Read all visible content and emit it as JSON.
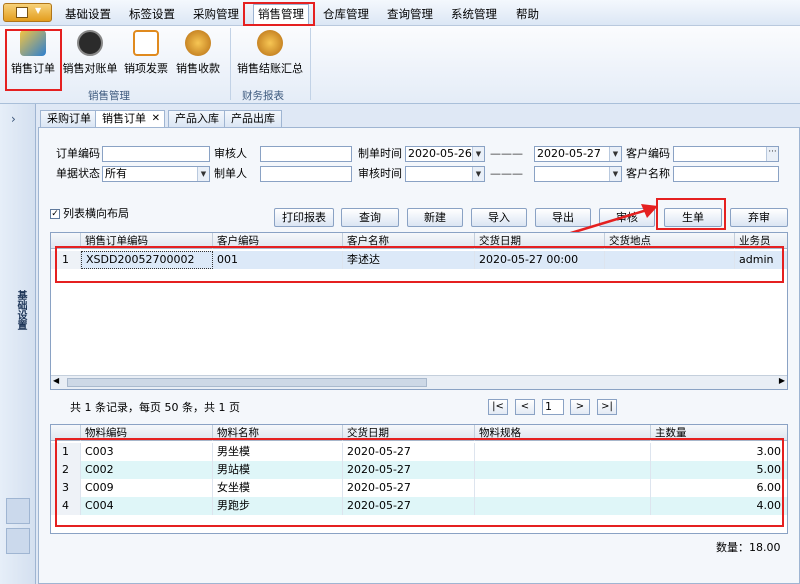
{
  "menubar": {
    "items": [
      "基础设置",
      "标签设置",
      "采购管理",
      "销售管理",
      "仓库管理",
      "查询管理",
      "系统管理",
      "帮助"
    ],
    "active": "销售管理"
  },
  "ribbon": {
    "buttons": [
      "销售订单",
      "销售对账单",
      "销项发票",
      "销售收款",
      "销售结账汇总"
    ],
    "groups": [
      "销售管理",
      "财务报表"
    ]
  },
  "leftpanel": {
    "label": "基础设置"
  },
  "tabs": [
    "采购订单",
    "销售订单",
    "产品入库",
    "产品出库"
  ],
  "filters": {
    "order_no_label": "订单编码",
    "reviewer_label": "审核人",
    "created_time_label": "制单时间",
    "date_from": "2020-05-26",
    "date_sep": "———",
    "date_to": "2020-05-27",
    "customer_code_label": "客户编码",
    "status_label": "单据状态",
    "status_value": "所有",
    "creator_label": "制单人",
    "review_time_label": "审核时间",
    "customer_name_label": "客户名称"
  },
  "toolbar": {
    "layout_checkbox": "列表横向布局",
    "print": "打印报表",
    "query": "查询",
    "new": "新建",
    "import": "导入",
    "export": "导出",
    "review": "审核",
    "generate": "生单",
    "abandon": "弃审"
  },
  "orders": {
    "columns": [
      "销售订单编码",
      "客户编码",
      "客户名称",
      "交货日期",
      "交货地点",
      "业务员"
    ],
    "rows": [
      {
        "n": "1",
        "code": "XSDD20052700002",
        "cust_code": "001",
        "cust_name": "李述达",
        "date": "2020-05-27 00:00",
        "place": "",
        "staff": "admin"
      }
    ]
  },
  "pager": {
    "summary": "共 1 条记录，每页 50 条，共 1 页",
    "first": "|<",
    "prev": "<",
    "page": "1",
    "next": ">",
    "last": ">|"
  },
  "details": {
    "columns": [
      "物料编码",
      "物料名称",
      "交货日期",
      "物料规格",
      "主数量"
    ],
    "rows": [
      {
        "n": "1",
        "code": "C003",
        "name": "男坐模",
        "date": "2020-05-27",
        "spec": "",
        "qty": "3.00"
      },
      {
        "n": "2",
        "code": "C002",
        "name": "男站模",
        "date": "2020-05-27",
        "spec": "",
        "qty": "5.00"
      },
      {
        "n": "3",
        "code": "C009",
        "name": "女坐模",
        "date": "2020-05-27",
        "spec": "",
        "qty": "6.00"
      },
      {
        "n": "4",
        "code": "C004",
        "name": "男跑步",
        "date": "2020-05-27",
        "spec": "",
        "qty": "4.00"
      }
    ],
    "total": "数量：18.00"
  }
}
